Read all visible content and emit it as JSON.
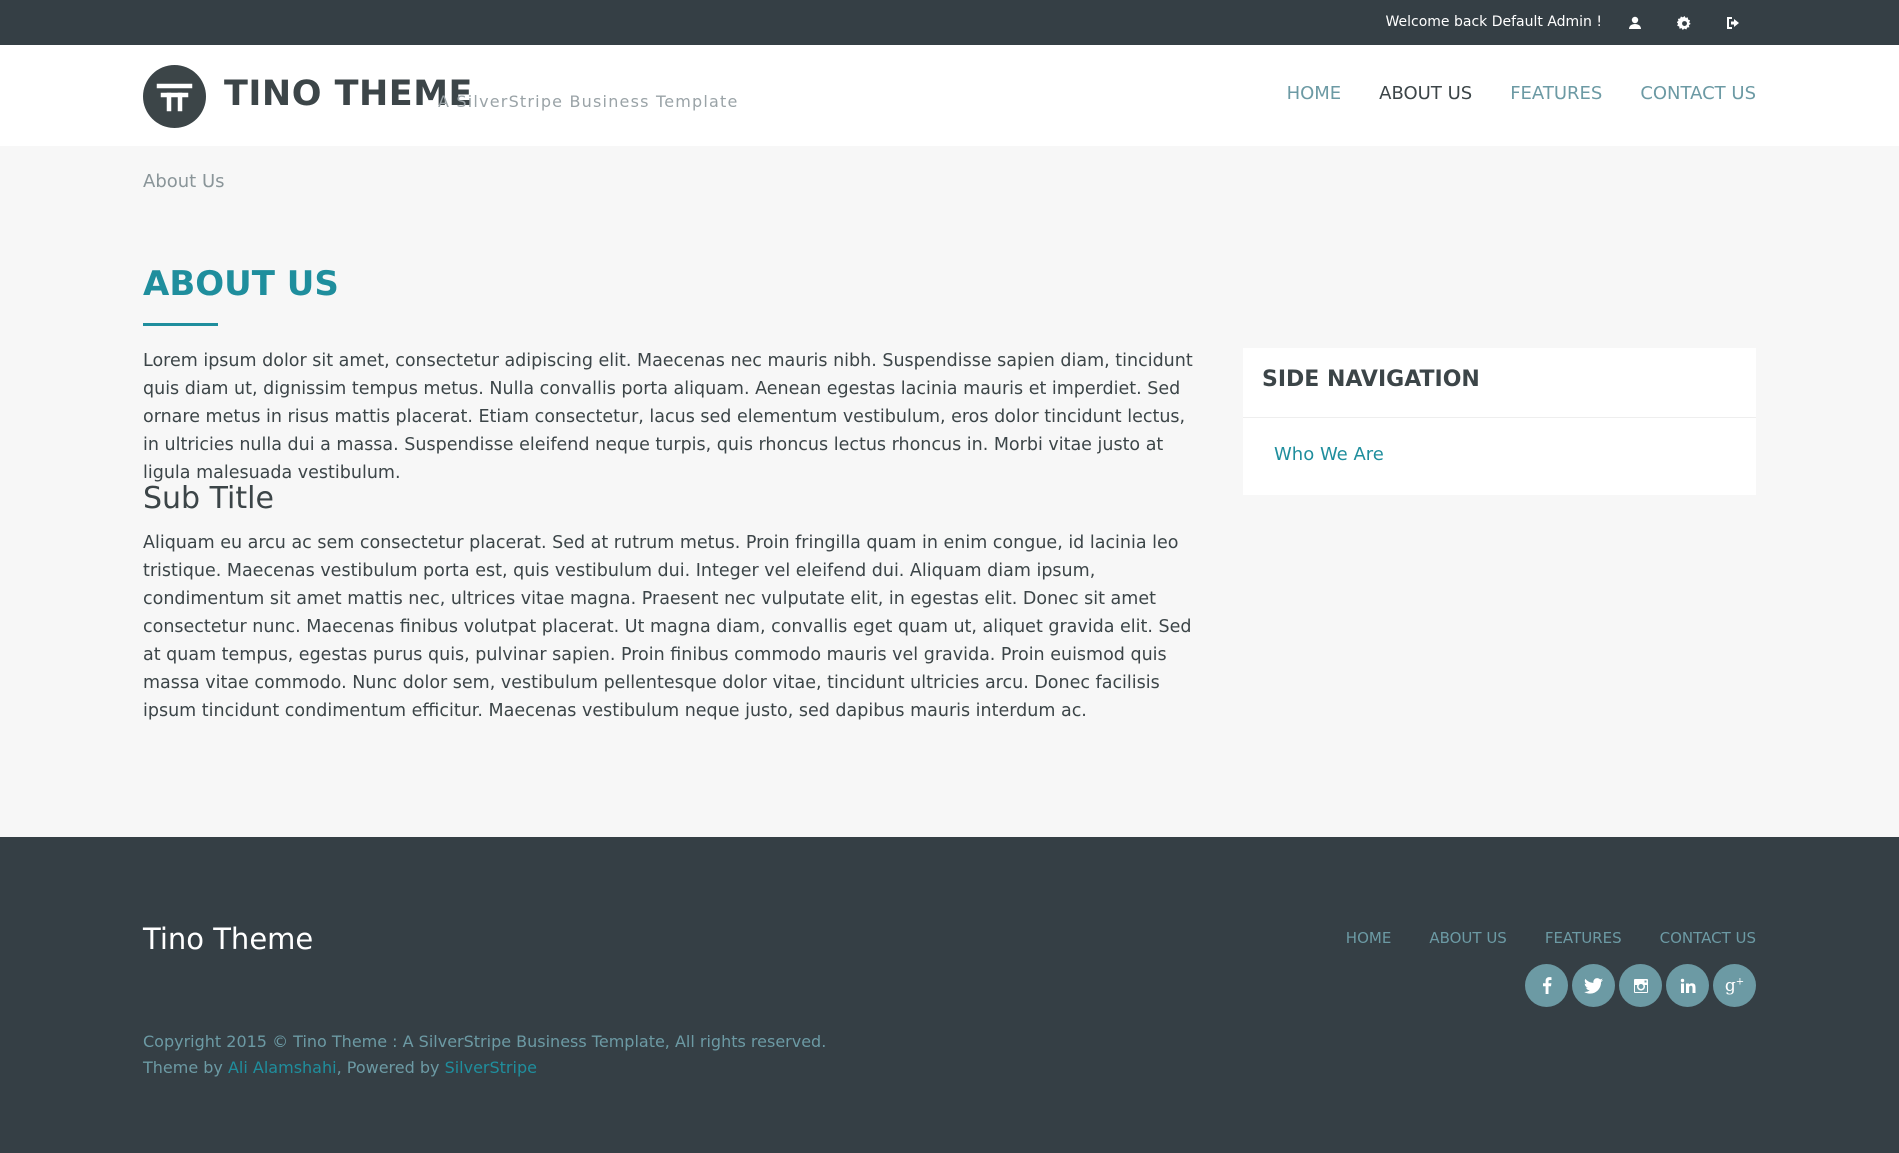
{
  "topbar": {
    "welcome": "Welcome back Default Admin !",
    "icons": [
      "user-icon",
      "gear-icon",
      "sign-out-icon"
    ]
  },
  "header": {
    "title": "TINO THEME",
    "tagline": "A SilverStripe Business Template",
    "nav": [
      {
        "label": "HOME",
        "active": false
      },
      {
        "label": "ABOUT US",
        "active": true
      },
      {
        "label": "FEATURES",
        "active": false
      },
      {
        "label": "CONTACT US",
        "active": false
      }
    ]
  },
  "breadcrumb": "About Us",
  "main": {
    "title": "ABOUT US",
    "paragraph1": "Lorem ipsum dolor sit amet, consectetur adipiscing elit. Maecenas nec mauris nibh. Suspendisse sapien diam, tincidunt quis diam ut, dignissim tempus metus. Nulla convallis porta aliquam. Aenean egestas lacinia mauris et imperdiet. Sed ornare metus in risus mattis placerat. Etiam consectetur, lacus sed elementum vestibulum, eros dolor tincidunt lectus, in ultricies nulla dui a massa. Suspendisse eleifend neque turpis, quis rhoncus lectus rhoncus in. Morbi vitae justo at ligula malesuada vestibulum.",
    "subtitle": "Sub Title",
    "paragraph2": "Aliquam eu arcu ac sem consectetur placerat. Sed at rutrum metus. Proin fringilla quam in enim congue, id lacinia leo tristique. Maecenas vestibulum porta est, quis vestibulum dui. Integer vel eleifend dui. Aliquam diam ipsum, condimentum sit amet mattis nec, ultrices vitae magna. Praesent nec vulputate elit, in egestas elit. Donec sit amet consectetur nunc. Maecenas finibus volutpat placerat. Ut magna diam, convallis eget quam ut, aliquet gravida elit. Sed at quam tempus, egestas purus quis, pulvinar sapien. Proin finibus commodo mauris vel gravida. Proin euismod quis massa vitae commodo. Nunc dolor sem, vestibulum pellentesque dolor vitae, tincidunt ultricies arcu. Donec facilisis ipsum tincidunt condimentum efficitur. Maecenas vestibulum neque justo, sed dapibus mauris interdum ac."
  },
  "sidenav": {
    "title": "SIDE NAVIGATION",
    "items": [
      {
        "label": "Who We Are"
      }
    ]
  },
  "footer": {
    "title": "Tino Theme",
    "nav": [
      {
        "label": "HOME"
      },
      {
        "label": "ABOUT US"
      },
      {
        "label": "FEATURES"
      },
      {
        "label": "CONTACT US"
      }
    ],
    "social": [
      "facebook-icon",
      "twitter-icon",
      "instagram-icon",
      "linkedin-icon",
      "google-plus-icon"
    ],
    "copyright": "Copyright 2015 © Tino Theme : A SilverStripe Business Template, All rights reserved.",
    "theme_by_prefix": "Theme by ",
    "theme_author": "Ali Alamshahi",
    "powered_by_prefix": ", Powered by ",
    "powered_by": "SilverStripe"
  },
  "colors": {
    "dark": "#353f45",
    "accent": "#1f8e9d",
    "muted_accent": "#6c9aa4",
    "background": "#f7f7f7"
  }
}
